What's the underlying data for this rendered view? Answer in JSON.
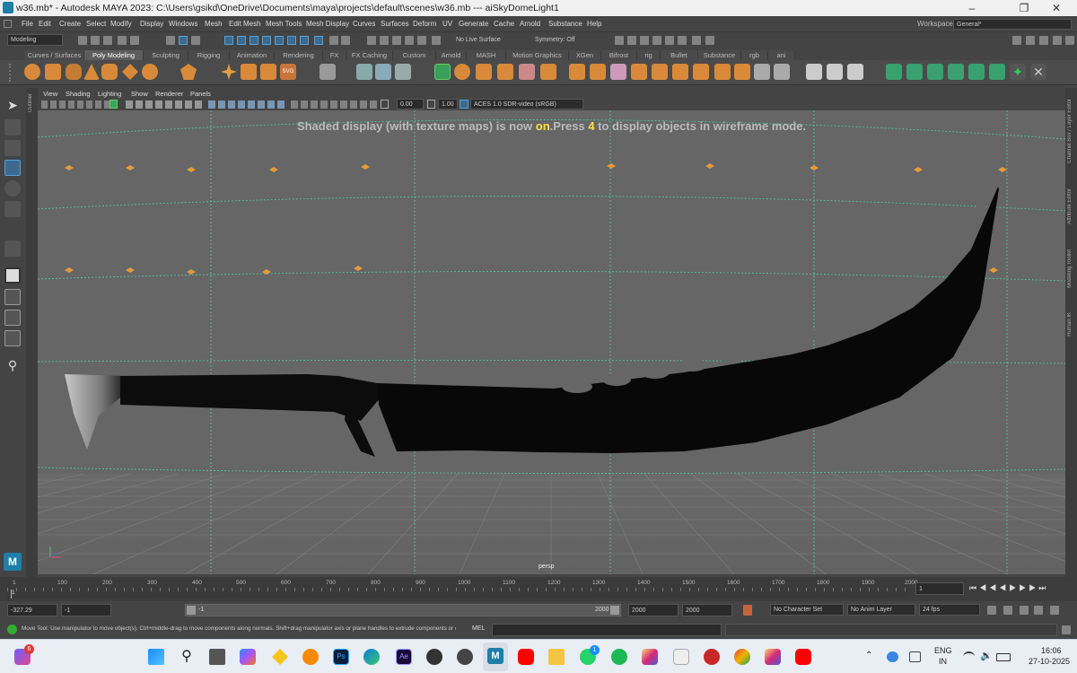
{
  "window": {
    "title": "w36.mb* - Autodesk MAYA 2023: C:\\Users\\gsikd\\OneDrive\\Documents\\maya\\projects\\default\\scenes\\w36.mb   ---   aiSkyDomeLight1"
  },
  "menubar": {
    "items": [
      "File",
      "Edit",
      "Create",
      "Select",
      "Modify",
      "Display",
      "Windows",
      "Mesh",
      "Edit Mesh",
      "Mesh Tools",
      "Mesh Display",
      "Curves",
      "Surfaces",
      "Deform",
      "UV",
      "Generate",
      "Cache",
      "Arnold",
      "Substance",
      "Help"
    ],
    "workspace_label": "Workspace:",
    "workspace_value": "General*"
  },
  "statusline": {
    "mode": "Modeling",
    "live_surface": "No Live Surface",
    "symmetry": "Symmetry: Off"
  },
  "shelf": {
    "tabs": [
      "Curves / Surfaces",
      "Poly Modeling",
      "Sculpting",
      "Rigging",
      "Animation",
      "Rendering",
      "FX",
      "FX Caching",
      "Custom",
      "Arnold",
      "MASH",
      "Motion Graphics",
      "XGen",
      "Bifrost",
      "rig",
      "Bullet",
      "Substance",
      "rgb",
      "ani"
    ],
    "active_tab": "Poly Modeling"
  },
  "panel": {
    "menus": [
      "View",
      "Shading",
      "Lighting",
      "Show",
      "Renderer",
      "Panels"
    ],
    "exposure": "0.00",
    "gamma": "1.00",
    "colorspace": "ACES 1.0 SDR-video (sRGB)",
    "camera_label": "persp",
    "hud": {
      "pre": "Shaded display (with texture maps) is now ",
      "on": "on",
      "mid": ".Press ",
      "key": "4",
      "post": " to display objects in wireframe mode."
    }
  },
  "side_tabs": {
    "left": "Outliner",
    "right": [
      "Channel Box / Layer Editor",
      "Attribute Editor",
      "Modeling Toolkit",
      "Human IK"
    ]
  },
  "timeline": {
    "ticks": [
      "1",
      "100",
      "200",
      "300",
      "400",
      "500",
      "600",
      "700",
      "800",
      "900",
      "1000",
      "1100",
      "1200",
      "1300",
      "1400",
      "1500",
      "1600",
      "1700",
      "1800",
      "1900",
      "2000"
    ],
    "current_frame": "1"
  },
  "range": {
    "start_value": "-327.29",
    "playback_start": "-1",
    "slider_start": "-1",
    "slider_end": "2000",
    "playback_end": "2000",
    "end_value": "2000",
    "character_set": "No Character Set",
    "anim_layer": "No Anim Layer",
    "fps": "24 fps"
  },
  "help": {
    "text": "Move Tool: Use manipulator to move object(s). Ctrl+middle-drag to move components along normals. Shift+drag manipulator axis or plane handles to extrude components or c",
    "mel": "MEL"
  },
  "taskbar": {
    "lang": "ENG",
    "region": "IN",
    "time": "16:06",
    "date": "27-10-2025",
    "widget_badge": "6",
    "whatsapp_badge": "1"
  },
  "colors": {
    "ui_bg": "#444444",
    "viewport_bg": "#666666",
    "highlight": "#ffe14d",
    "selected_blue": "#5a9fd4",
    "grid_green": "#56c49a"
  }
}
